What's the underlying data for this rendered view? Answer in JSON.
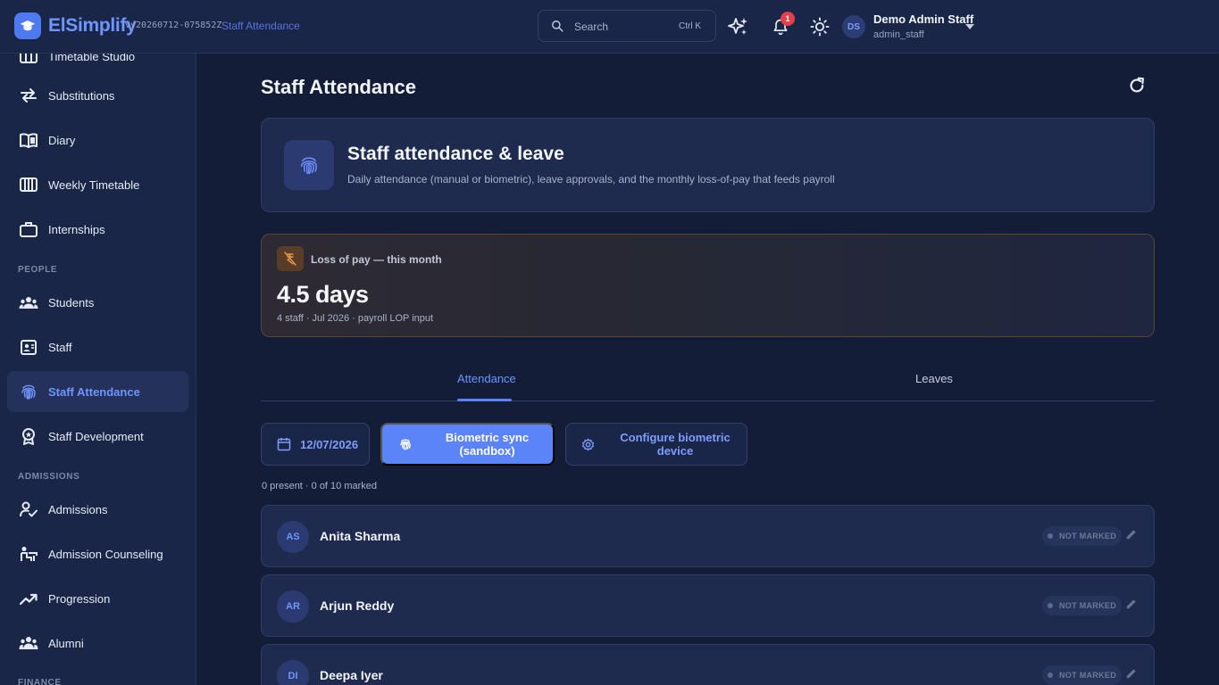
{
  "app": {
    "brand": "ElSimplify",
    "version": "vv20260712-075852Z",
    "breadcrumb": "Staff Attendance",
    "accent_color": "#5b84f8"
  },
  "topbar": {
    "search_placeholder": "Search",
    "search_shortcut": "Ctrl K",
    "notification_count": "1",
    "user": {
      "initials": "DS",
      "name": "Demo Admin Staff",
      "role": "admin_staff"
    }
  },
  "sidebar": {
    "items": [
      {
        "label": "Timetable Studio",
        "icon": "timetable-icon"
      },
      {
        "label": "Substitutions",
        "icon": "swap-arrows-icon"
      },
      {
        "label": "Diary",
        "icon": "book-icon"
      },
      {
        "label": "Weekly Timetable",
        "icon": "calendar-grid-icon"
      },
      {
        "label": "Internships",
        "icon": "briefcase-icon"
      },
      {
        "label": "Students",
        "icon": "group-icon"
      },
      {
        "label": "Staff",
        "icon": "id-card-icon"
      },
      {
        "label": "Staff Attendance",
        "icon": "fingerprint-icon",
        "active": true
      },
      {
        "label": "Staff Development",
        "icon": "award-icon"
      },
      {
        "label": "Admissions",
        "icon": "person-check-icon"
      },
      {
        "label": "Admission Counseling",
        "icon": "counseling-icon"
      },
      {
        "label": "Progression",
        "icon": "trending-up-icon"
      },
      {
        "label": "Alumni",
        "icon": "people-icon"
      }
    ],
    "sections": {
      "people": "PEOPLE",
      "admissions": "ADMISSIONS",
      "finance": "FINANCE"
    }
  },
  "main": {
    "page_title": "Staff Attendance",
    "hero": {
      "title": "Staff attendance & leave",
      "subtitle": "Daily attendance (manual or biometric), leave approvals, and the monthly loss-of-pay that feeds payroll"
    },
    "lop": {
      "label": "Loss of pay — this month",
      "value": "4.5 days",
      "detail": "4 staff · Jul 2026 · payroll LOP input"
    },
    "tabs": [
      {
        "label": "Attendance",
        "active": true
      },
      {
        "label": "Leaves"
      }
    ],
    "actions": {
      "date": "12/07/2026",
      "biometric_sync": "Biometric sync (sandbox)",
      "configure": "Configure biometric device"
    },
    "summary": "0 present · 0 of 10 marked",
    "staff": [
      {
        "initials": "AS",
        "name": "Anita Sharma",
        "status": "NOT MARKED"
      },
      {
        "initials": "AR",
        "name": "Arjun Reddy",
        "status": "NOT MARKED"
      },
      {
        "initials": "DI",
        "name": "Deepa Iyer",
        "status": "NOT MARKED"
      }
    ]
  }
}
